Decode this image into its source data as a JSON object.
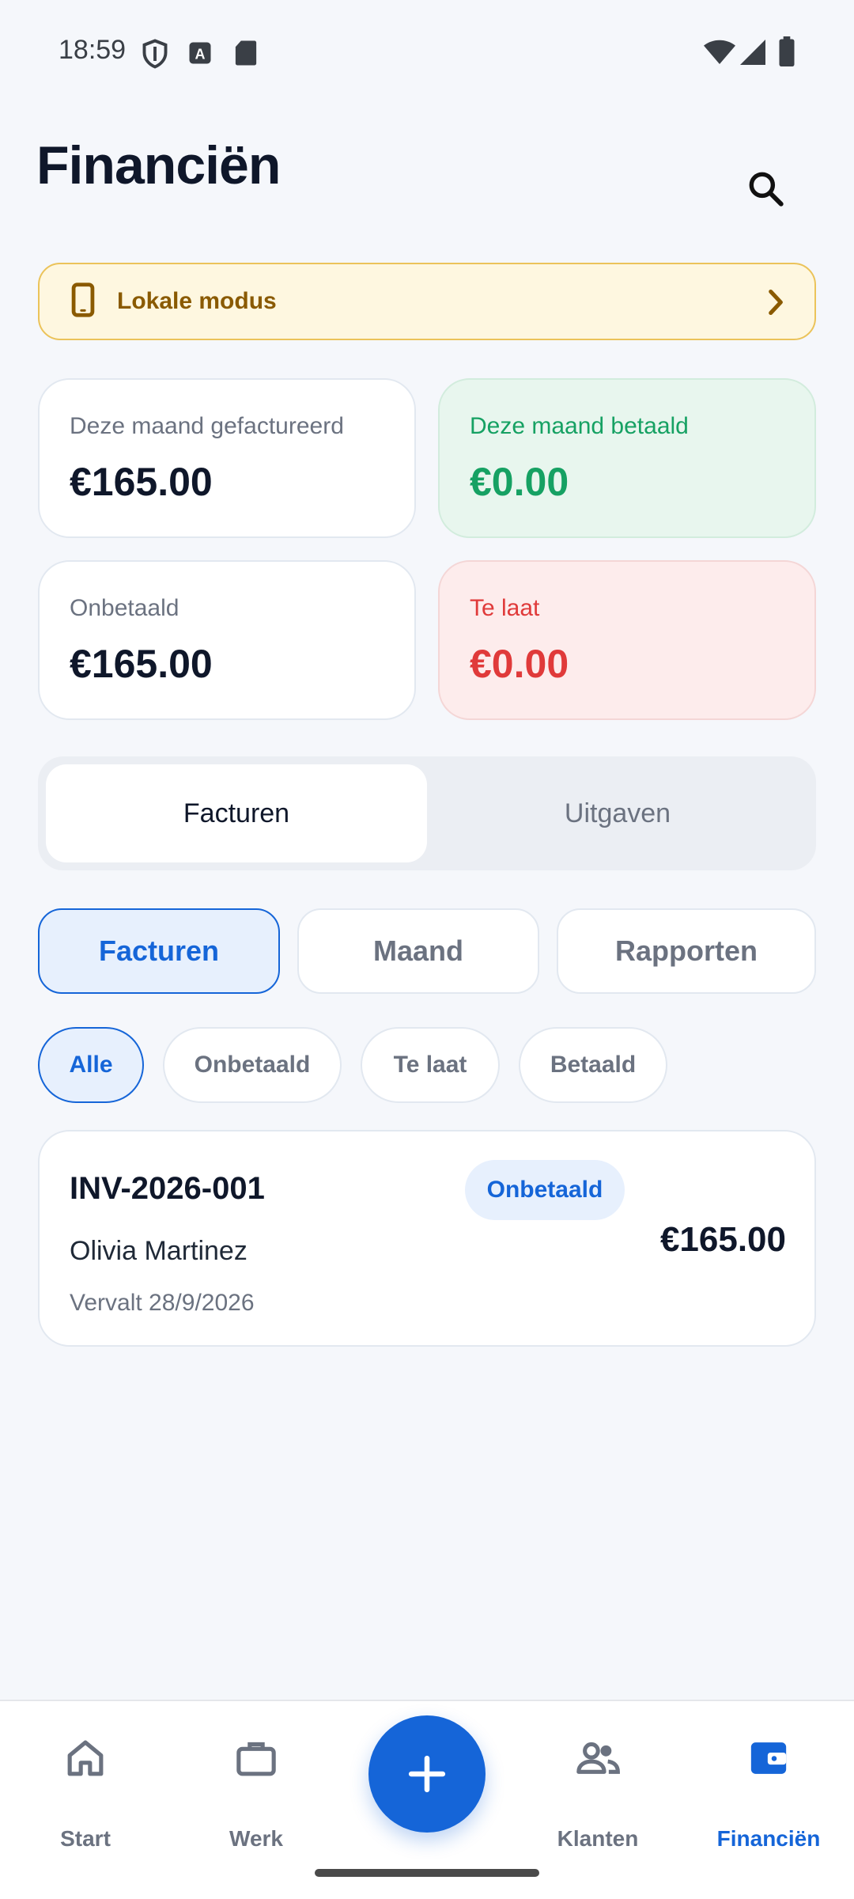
{
  "status_bar": {
    "time": "18:59",
    "icons": [
      "shield-icon",
      "text-badge-icon",
      "sd-card-icon",
      "wifi-icon",
      "signal-icon",
      "battery-icon"
    ]
  },
  "header": {
    "title": "Financiën",
    "search_icon": "search-icon"
  },
  "banner": {
    "label": "Lokale modus",
    "icon": "phone-icon",
    "chevron": "chevron-right-icon"
  },
  "stats": {
    "invoiced_month": {
      "label": "Deze maand gefactureerd",
      "value": "€165.00"
    },
    "paid_month": {
      "label": "Deze maand betaald",
      "value": "€0.00"
    },
    "unpaid": {
      "label": "Onbetaald",
      "value": "€165.00"
    },
    "overdue": {
      "label": "Te laat",
      "value": "€0.00"
    }
  },
  "segment": {
    "active": "Facturen",
    "inactive": "Uitgaven"
  },
  "subtabs": {
    "first": "Facturen",
    "second": "Maand",
    "third": "Rapporten",
    "selected": "Facturen"
  },
  "filters": {
    "all": "Alle",
    "unpaid": "Onbetaald",
    "late": "Te laat",
    "paid": "Betaald",
    "selected": "Alle"
  },
  "invoices": [
    {
      "number": "INV-2026-001",
      "status": "Onbetaald",
      "client": "Olivia Martinez",
      "due": "Vervalt 28/9/2026",
      "amount": "€165.00"
    }
  ],
  "bottom_nav": {
    "start": "Start",
    "werk": "Werk",
    "klanten": "Klanten",
    "financien": "Financiën",
    "active": "Financiën"
  },
  "colors": {
    "accent": "#1565D8",
    "paid_green": "#16A163",
    "overdue_red": "#E03A3A",
    "banner_bg": "#FEF7E0",
    "banner_text": "#8A5A00"
  }
}
